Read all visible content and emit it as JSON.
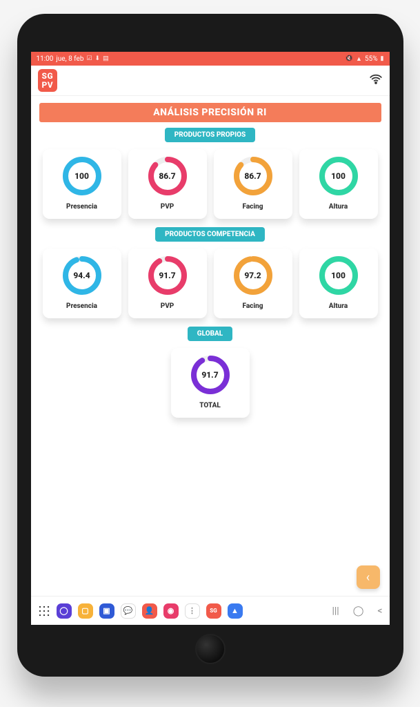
{
  "status": {
    "time": "11:00",
    "date": "jue, 8 feb",
    "battery": "55%"
  },
  "app": {
    "logo_line1": "SG",
    "logo_line2": "PV",
    "title": "ANÁLISIS PRECISIÓN RI"
  },
  "sections": [
    {
      "heading": "PRODUCTOS PROPIOS",
      "cards": [
        {
          "value": 100,
          "display": "100",
          "label": "Presencia",
          "color": "#2fb6e6"
        },
        {
          "value": 86.7,
          "display": "86.7",
          "label": "PVP",
          "color": "#e83c6a"
        },
        {
          "value": 86.7,
          "display": "86.7",
          "label": "Facing",
          "color": "#f2a23a"
        },
        {
          "value": 100,
          "display": "100",
          "label": "Altura",
          "color": "#2fd6a4"
        }
      ]
    },
    {
      "heading": "PRODUCTOS COMPETENCIA",
      "cards": [
        {
          "value": 94.4,
          "display": "94.4",
          "label": "Presencia",
          "color": "#2fb6e6"
        },
        {
          "value": 91.7,
          "display": "91.7",
          "label": "PVP",
          "color": "#e83c6a"
        },
        {
          "value": 97.2,
          "display": "97.2",
          "label": "Facing",
          "color": "#f2a23a"
        },
        {
          "value": 100,
          "display": "100",
          "label": "Altura",
          "color": "#2fd6a4"
        }
      ]
    },
    {
      "heading": "GLOBAL",
      "cards": [
        {
          "value": 91.7,
          "display": "91.7",
          "label": "TOTAL",
          "color": "#7a2fd6"
        }
      ]
    }
  ],
  "chart_data": [
    {
      "type": "pie",
      "title": "Productos Propios",
      "series": [
        {
          "name": "Presencia",
          "values": [
            100
          ]
        },
        {
          "name": "PVP",
          "values": [
            86.7
          ]
        },
        {
          "name": "Facing",
          "values": [
            86.7
          ]
        },
        {
          "name": "Altura",
          "values": [
            100
          ]
        }
      ],
      "ylim": [
        0,
        100
      ]
    },
    {
      "type": "pie",
      "title": "Productos Competencia",
      "series": [
        {
          "name": "Presencia",
          "values": [
            94.4
          ]
        },
        {
          "name": "PVP",
          "values": [
            91.7
          ]
        },
        {
          "name": "Facing",
          "values": [
            97.2
          ]
        },
        {
          "name": "Altura",
          "values": [
            100
          ]
        }
      ],
      "ylim": [
        0,
        100
      ]
    },
    {
      "type": "pie",
      "title": "Global",
      "series": [
        {
          "name": "TOTAL",
          "values": [
            91.7
          ]
        }
      ],
      "ylim": [
        0,
        100
      ]
    }
  ],
  "dock": {
    "apps": [
      {
        "name": "browser",
        "bg": "#5a3fd6",
        "glyph": "◯"
      },
      {
        "name": "files",
        "bg": "#f7b23a",
        "glyph": "▢"
      },
      {
        "name": "tv",
        "bg": "#2f5ad6",
        "glyph": "▣"
      },
      {
        "name": "chat",
        "bg": "#ffffff",
        "glyph": "💬",
        "fg": "#3a7"
      },
      {
        "name": "contacts",
        "bg": "#f15a4a",
        "glyph": "👤"
      },
      {
        "name": "camera",
        "bg": "#e83c6a",
        "glyph": "◉"
      },
      {
        "name": "menu",
        "bg": "#ffffff",
        "glyph": "⋮",
        "fg": "#888"
      },
      {
        "name": "sgpv",
        "bg": "#f15a4a",
        "glyph": "SG"
      },
      {
        "name": "dashboard",
        "bg": "#3a7af0",
        "glyph": "▲"
      }
    ]
  }
}
